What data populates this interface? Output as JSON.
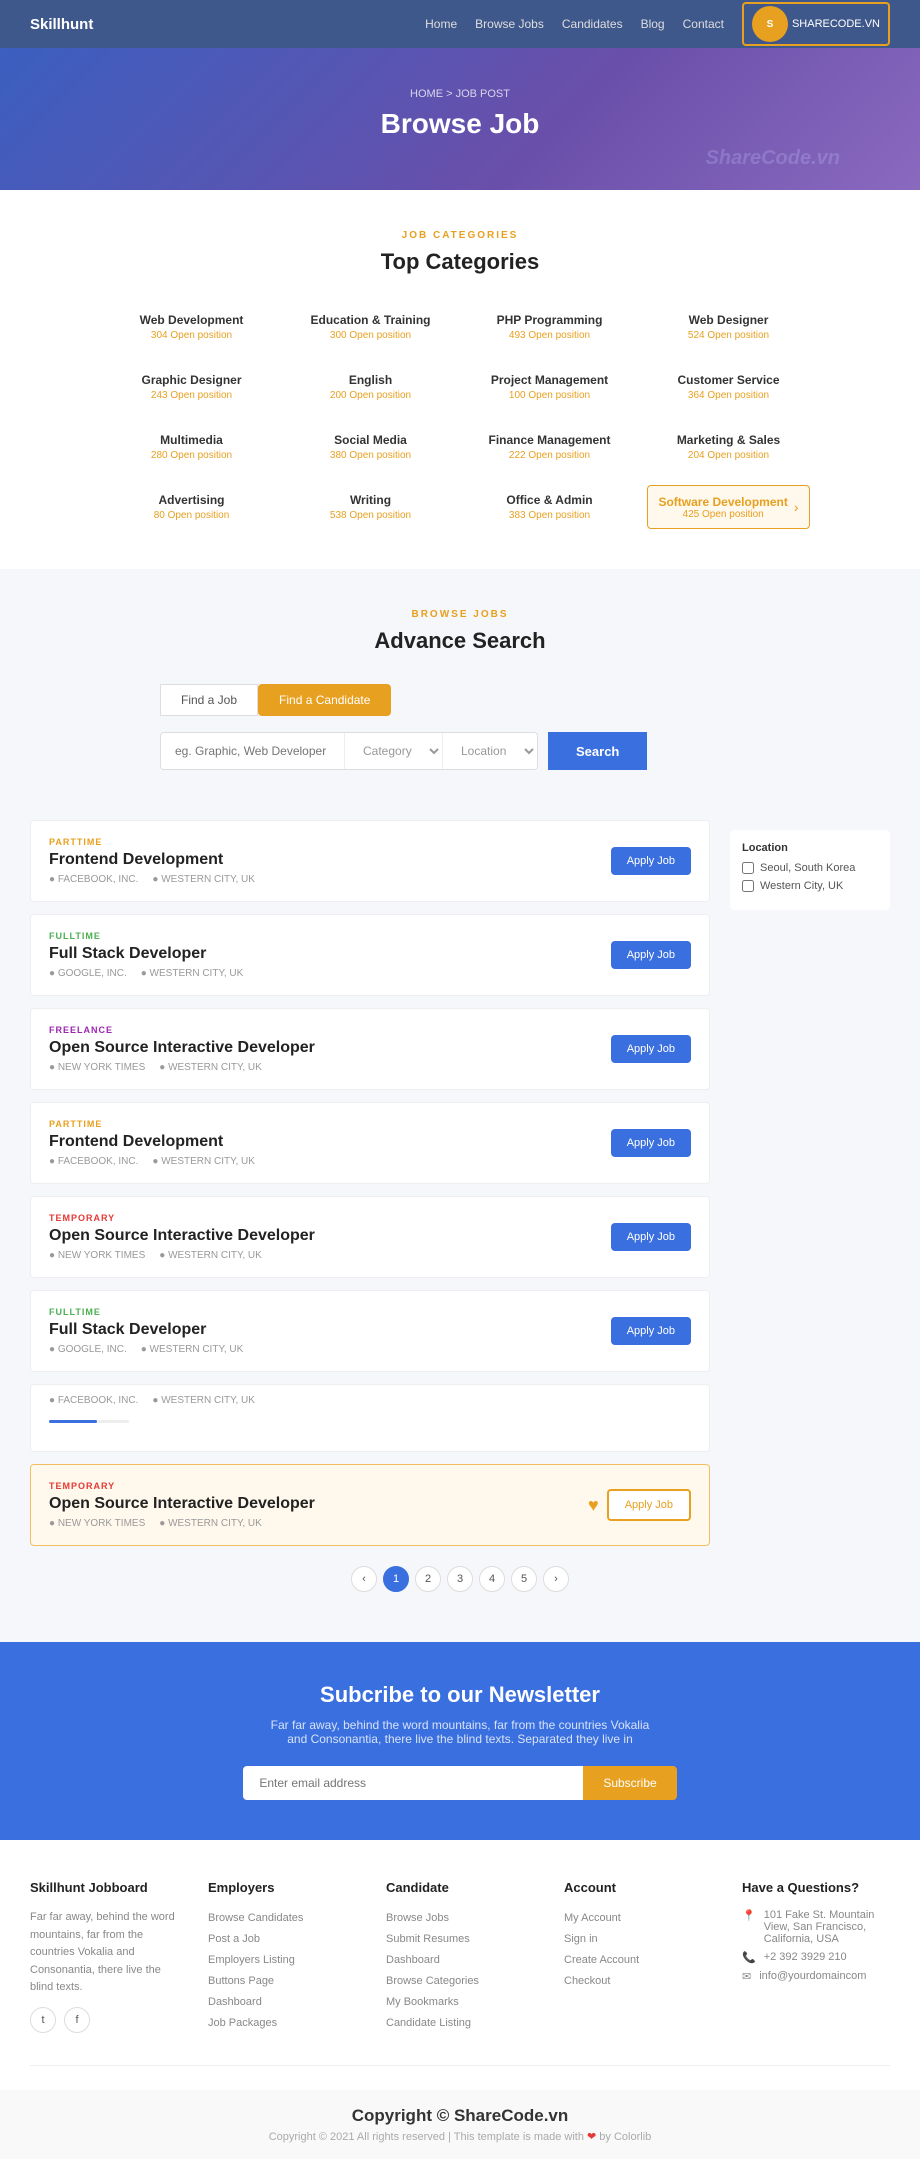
{
  "nav": {
    "brand": "Skillhunt",
    "links": [
      "Home",
      "Browse Jobs",
      "Candidates",
      "Blog",
      "Contact"
    ],
    "logo_text": "SHARECODE.VN"
  },
  "hero": {
    "breadcrumb": "HOME > JOB POST",
    "title": "Browse Job",
    "watermark": "ShareCode.vn"
  },
  "categories": {
    "label": "JOB CATEGORIES",
    "title": "Top Categories",
    "items": [
      {
        "name": "Web Development",
        "count": "304 Open position"
      },
      {
        "name": "Education & Training",
        "count": "300 Open position"
      },
      {
        "name": "PHP Programming",
        "count": "493 Open position"
      },
      {
        "name": "Web Designer",
        "count": "524 Open position"
      },
      {
        "name": "Graphic Designer",
        "count": "243 Open position"
      },
      {
        "name": "English",
        "count": "200 Open position"
      },
      {
        "name": "Project Management",
        "count": "100 Open position"
      },
      {
        "name": "Customer Service",
        "count": "364 Open position"
      },
      {
        "name": "Multimedia",
        "count": "280 Open position"
      },
      {
        "name": "Social Media",
        "count": "380 Open position"
      },
      {
        "name": "Finance Management",
        "count": "222 Open position"
      },
      {
        "name": "Marketing & Sales",
        "count": "204 Open position"
      },
      {
        "name": "Advertising",
        "count": "80 Open position"
      },
      {
        "name": "Writing",
        "count": "538 Open position"
      },
      {
        "name": "Office & Admin",
        "count": "383 Open position"
      },
      {
        "name": "Software Development",
        "count": "425 Open position",
        "highlight": true
      }
    ]
  },
  "search": {
    "label": "BROWSE JOBS",
    "title": "Advance Search",
    "tabs": [
      "Find a Job",
      "Find a Candidate"
    ],
    "active_tab": 1,
    "input_placeholder": "eg. Graphic, Web Developer",
    "category_placeholder": "Category",
    "location_placeholder": "Location",
    "button_label": "Search"
  },
  "jobs": [
    {
      "type": "PARTTIME",
      "type_class": "parttime",
      "title": "Frontend Development",
      "company": "FACEBOOK, INC.",
      "location": "WESTERN CITY, UK",
      "btn": "Apply Job"
    },
    {
      "type": "FULLTIME",
      "type_class": "fulltime",
      "title": "Full Stack Developer",
      "company": "GOOGLE, INC.",
      "location": "WESTERN CITY, UK",
      "btn": "Apply Job"
    },
    {
      "type": "FREELANCE",
      "type_class": "freelance",
      "title": "Open Source Interactive Developer",
      "company": "NEW YORK TIMES",
      "location": "WESTERN CITY, UK",
      "btn": "Apply Job"
    },
    {
      "type": "PARTTIME",
      "type_class": "parttime",
      "title": "Frontend Development",
      "company": "FACEBOOK, INC.",
      "location": "WESTERN CITY, UK",
      "btn": "Apply Job"
    },
    {
      "type": "TEMPORARY",
      "type_class": "temporary",
      "title": "Open Source Interactive Developer",
      "company": "NEW YORK TIMES",
      "location": "WESTERN CITY, UK",
      "btn": "Apply Job"
    },
    {
      "type": "FULLTIME",
      "type_class": "fulltime",
      "title": "Full Stack Developer",
      "company": "GOOGLE, INC.",
      "location": "WESTERN CITY, UK",
      "btn": "Apply Job"
    },
    {
      "type": "TEMPORARY",
      "type_class": "temporary",
      "title": "Open Source Interactive Developer",
      "company": "NEW YORK TIMES",
      "location": "WESTERN CITY, UK",
      "btn": "Apply Job",
      "heart": true
    }
  ],
  "sidebar": {
    "locations": [
      {
        "label": "Seoul, South Korea"
      },
      {
        "label": "Western City, UK"
      }
    ]
  },
  "pagination": {
    "pages": [
      "1",
      "2",
      "3",
      "4",
      "5"
    ],
    "active": "1"
  },
  "newsletter": {
    "title": "Subcribe to our Newsletter",
    "text": "Far far away, behind the word mountains, far from the countries Vokalia and Consonantia, there live the blind texts. Separated they live in",
    "placeholder": "Enter email address",
    "button": "Subscribe"
  },
  "footer": {
    "col1": {
      "title": "Skillhunt Jobboard",
      "text": "Far far away, behind the word mountains, far from the countries Vokalia and Consonantia, there live the blind texts.",
      "social": [
        "t",
        "f"
      ]
    },
    "col2": {
      "title": "Employers",
      "links": [
        "Browse Candidates",
        "Post a Job",
        "Employers Listing",
        "Buttons Page",
        "Dashboard",
        "Job Packages"
      ]
    },
    "col3": {
      "title": "Candidate",
      "links": [
        "Browse Jobs",
        "Submit Resumes",
        "Dashboard",
        "Browse Categories",
        "My Bookmarks",
        "Candidate Listing"
      ]
    },
    "col4": {
      "title": "Account",
      "links": [
        "My Account",
        "Sign in",
        "Create Account",
        "Checkout"
      ]
    },
    "col5": {
      "title": "Have a Questions?",
      "address": "101 Fake St. Mountain View, San Francisco, California, USA",
      "phone": "+2 392 3929 210",
      "email": "info@yourdomaincom"
    }
  },
  "footer_bottom": {
    "title": "Copyright © ShareCode.vn",
    "copy": "Copyright © 2021 All rights reserved | This template is made with ❤ by Colorlib"
  }
}
